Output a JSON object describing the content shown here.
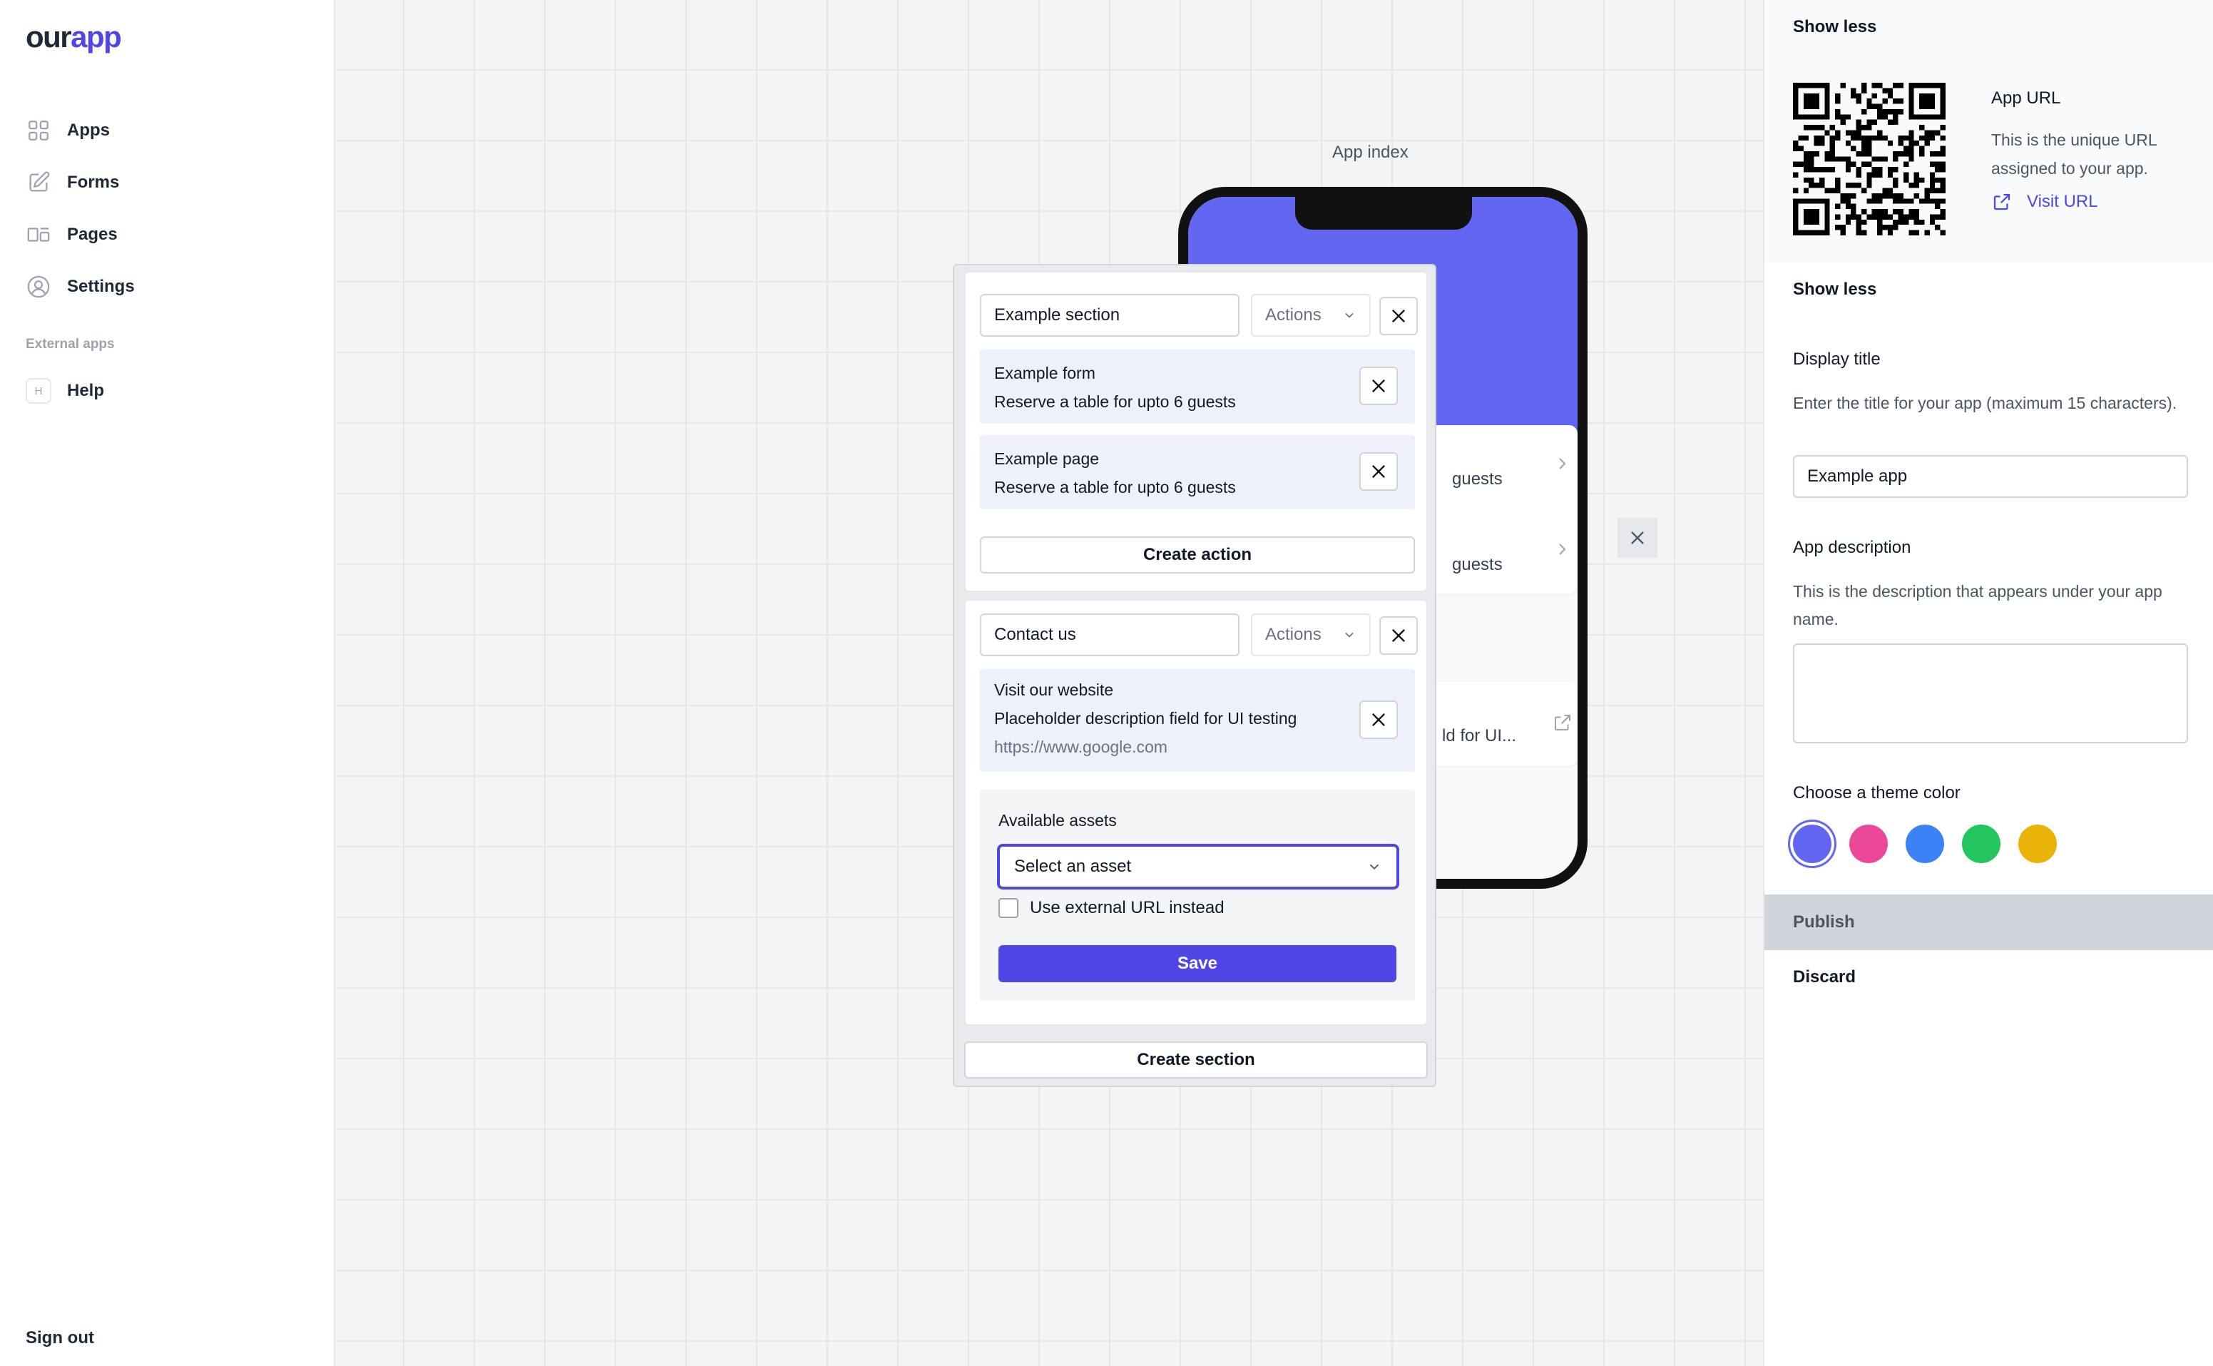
{
  "brand": {
    "logo_our": "our",
    "logo_app": "app"
  },
  "sidebar": {
    "items": [
      {
        "label": "Apps",
        "icon": "grid-icon"
      },
      {
        "label": "Forms",
        "icon": "edit-icon"
      },
      {
        "label": "Pages",
        "icon": "pages-icon"
      },
      {
        "label": "Settings",
        "icon": "user-circle-icon"
      }
    ],
    "external_title": "External apps",
    "help": {
      "badge": "H",
      "label": "Help"
    },
    "sign_out": "Sign out"
  },
  "canvas": {
    "app_index_label": "App index",
    "phone": {
      "rows": [
        {
          "text": "guests"
        },
        {
          "text": "guests"
        },
        {
          "text": "ld for UI..."
        }
      ]
    }
  },
  "editor": {
    "section1": {
      "name": "Example section",
      "actions_label": "Actions",
      "items": [
        {
          "title": "Example form",
          "subtitle": "Reserve a table for upto 6 guests"
        },
        {
          "title": "Example page",
          "subtitle": "Reserve a table for upto 6 guests"
        }
      ],
      "create_action": "Create action"
    },
    "section2": {
      "name": "Contact us",
      "actions_label": "Actions",
      "item": {
        "title": "Visit our website",
        "subtitle": "Placeholder description field for UI testing",
        "url": "https://www.google.com"
      },
      "assets_label": "Available assets",
      "asset_select": "Select an asset",
      "external_url_checkbox": "Use external URL instead",
      "external_url_checked": false,
      "save": "Save"
    },
    "create_section": "Create section"
  },
  "right_panel": {
    "show_less_top": "Show less",
    "app_url": {
      "title": "App URL",
      "description": "This is the unique URL assigned to your app.",
      "link": "Visit URL"
    },
    "show_less_bottom": "Show less",
    "display_title": {
      "label": "Display title",
      "help": "Enter the title for your app (maximum 15 characters).",
      "value": "Example app"
    },
    "app_description": {
      "label": "App description",
      "help": "This is the description that appears under your app name.",
      "value": ""
    },
    "theme": {
      "label": "Choose a theme color",
      "colors": [
        "#6366f1",
        "#ec4899",
        "#3b82f6",
        "#22c55e",
        "#eab308"
      ],
      "selected_index": 0
    },
    "publish": "Publish",
    "discard": "Discard"
  },
  "colors": {
    "accent": "#4f46e5",
    "phone_header": "#6366f1"
  }
}
